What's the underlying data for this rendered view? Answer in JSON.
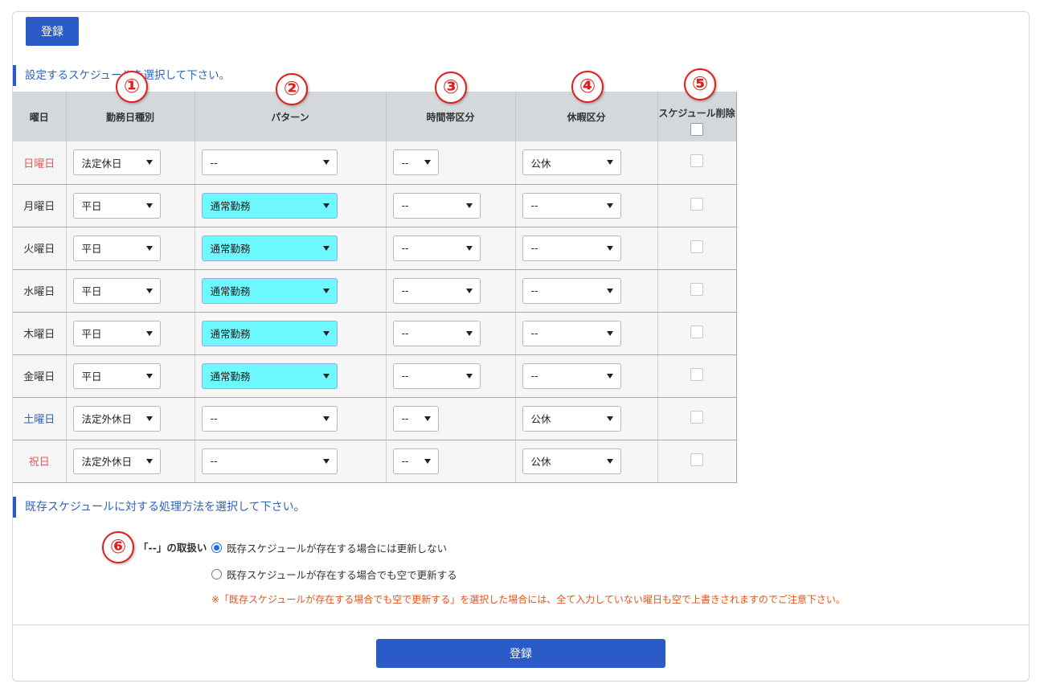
{
  "buttons": {
    "top_register": "登録",
    "bottom_register": "登録"
  },
  "sections": {
    "schedule_title": "設定するスケジュールを選択して下さい。",
    "existing_title": "既存スケジュールに対する処理方法を選択して下さい。"
  },
  "markers": [
    "①",
    "②",
    "③",
    "④",
    "⑤",
    "⑥"
  ],
  "table": {
    "headers": {
      "day": "曜日",
      "work_type": "勤務日種別",
      "pattern": "パターン",
      "time_slot": "時間帯区分",
      "leave": "休暇区分",
      "delete": "スケジュール削除"
    },
    "rows": [
      {
        "day": "日曜日",
        "work_type": "法定休日",
        "pattern": "--",
        "time_slot": "--",
        "leave": "公休"
      },
      {
        "day": "月曜日",
        "work_type": "平日",
        "pattern": "通常勤務",
        "time_slot": "--",
        "leave": "--"
      },
      {
        "day": "火曜日",
        "work_type": "平日",
        "pattern": "通常勤務",
        "time_slot": "--",
        "leave": "--"
      },
      {
        "day": "水曜日",
        "work_type": "平日",
        "pattern": "通常勤務",
        "time_slot": "--",
        "leave": "--"
      },
      {
        "day": "木曜日",
        "work_type": "平日",
        "pattern": "通常勤務",
        "time_slot": "--",
        "leave": "--"
      },
      {
        "day": "金曜日",
        "work_type": "平日",
        "pattern": "通常勤務",
        "time_slot": "--",
        "leave": "--"
      },
      {
        "day": "土曜日",
        "work_type": "法定外休日",
        "pattern": "--",
        "time_slot": "--",
        "leave": "公休"
      },
      {
        "day": "祝日",
        "work_type": "法定外休日",
        "pattern": "--",
        "time_slot": "--",
        "leave": "公休"
      }
    ]
  },
  "options": {
    "label": "「--」の取扱い",
    "choice_1": "既存スケジュールが存在する場合には更新しない",
    "choice_2": "既存スケジュールが存在する場合でも空で更新する",
    "selected": 1,
    "note": "※「既存スケジュールが存在する場合でも空で更新する」を選択した場合には、全て入力していない曜日も空で上書きされますのでご注意下さい。"
  },
  "colors": {
    "accent": "#2a5bc7",
    "pattern_highlight": "#6ef9ff",
    "sunday_holiday": "#e25a5a",
    "saturday": "#2e63b8",
    "note": "#e2541c",
    "marker": "#e21d1d"
  }
}
